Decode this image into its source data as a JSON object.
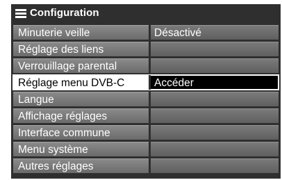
{
  "header": {
    "title": "Configuration",
    "icon": "menu-list-icon"
  },
  "menu": {
    "selected_index": 3,
    "items": [
      {
        "label": "Minuterie veille",
        "value": "Désactivé"
      },
      {
        "label": "Réglage des liens",
        "value": ""
      },
      {
        "label": "Verrouillage parental",
        "value": ""
      },
      {
        "label": "Réglage menu DVB-C",
        "value": "Accéder"
      },
      {
        "label": "Langue",
        "value": ""
      },
      {
        "label": "Affichage réglages",
        "value": ""
      },
      {
        "label": "Interface commune",
        "value": ""
      },
      {
        "label": "Menu système",
        "value": ""
      },
      {
        "label": "Autres réglages",
        "value": ""
      }
    ]
  },
  "colors": {
    "panel_background": "#2f2f2f",
    "row_background": "#7a7a7a",
    "selected_label_background": "#ffffff",
    "selected_value_background": "#000000"
  }
}
